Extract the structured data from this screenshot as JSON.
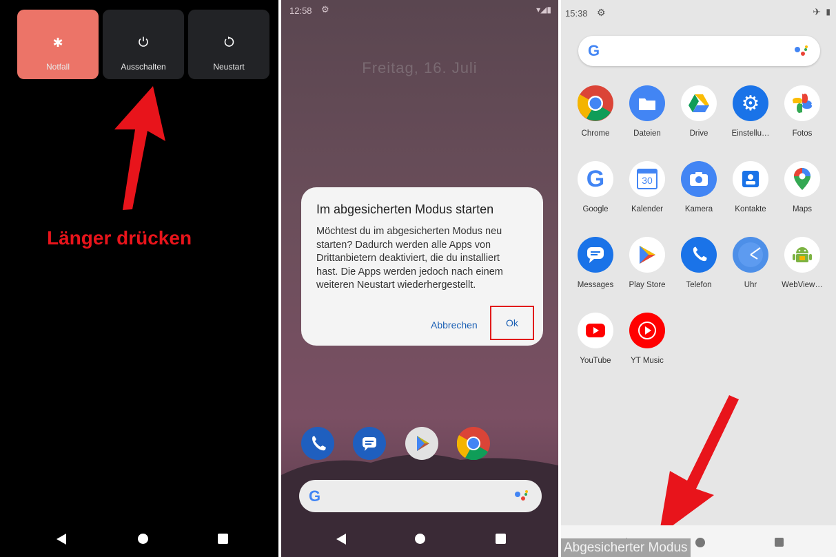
{
  "panel1": {
    "buttons": [
      {
        "label": "Notfall"
      },
      {
        "label": "Ausschalten"
      },
      {
        "label": "Neustart"
      }
    ],
    "annotation": "Länger drücken",
    "annotation_color": "#e8141b"
  },
  "panel2": {
    "time": "12:58",
    "date": "Freitag, 16. Juli",
    "dialog": {
      "title": "Im abgesicherten Modus starten",
      "message": "Möchtest du im abgesicherten Modus neu starten? Dadurch werden alle Apps von Drittanbietern deaktiviert, die du installiert hast. Die Apps werden jedoch nach einem weiteren Neustart wiederhergestellt.",
      "cancel": "Abbrechen",
      "ok": "Ok"
    }
  },
  "panel3": {
    "time": "15:38",
    "apps": [
      {
        "name": "Chrome",
        "icon": "chrome-icon"
      },
      {
        "name": "Dateien",
        "icon": "files-icon"
      },
      {
        "name": "Drive",
        "icon": "drive-icon"
      },
      {
        "name": "Einstellu…",
        "icon": "settings-icon"
      },
      {
        "name": "Fotos",
        "icon": "photos-icon"
      },
      {
        "name": "Google",
        "icon": "google-icon"
      },
      {
        "name": "Kalender",
        "icon": "calendar-icon"
      },
      {
        "name": "Kamera",
        "icon": "camera-icon"
      },
      {
        "name": "Kontakte",
        "icon": "contacts-icon"
      },
      {
        "name": "Maps",
        "icon": "maps-icon"
      },
      {
        "name": "Messages",
        "icon": "messages-icon"
      },
      {
        "name": "Play Store",
        "icon": "play-store-icon"
      },
      {
        "name": "Telefon",
        "icon": "phone-icon"
      },
      {
        "name": "Uhr",
        "icon": "clock-icon"
      },
      {
        "name": "WebView…",
        "icon": "android-icon"
      },
      {
        "name": "YouTube",
        "icon": "youtube-icon"
      },
      {
        "name": "YT Music",
        "icon": "yt-music-icon"
      }
    ],
    "calendar_day": "30",
    "safe_mode_label": "Abgesicherter Modus"
  }
}
